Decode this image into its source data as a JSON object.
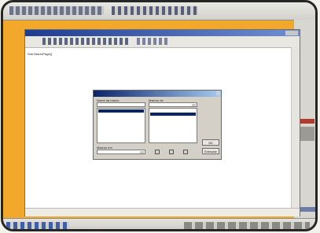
{
  "document": {
    "text": "Sub MacroPage()"
  },
  "dialog": {
    "title": "",
    "macro_name_label": "Nome da macro",
    "macro_in_label": "Macros de",
    "macros_in_label": "Macros em",
    "description_label": "",
    "run_button": "Executar",
    "ok_button": "OK"
  },
  "colors": {
    "frame_orange": "#f2a92b",
    "selection_blue": "#0a246a",
    "title_blue": "#1f3c8f"
  }
}
